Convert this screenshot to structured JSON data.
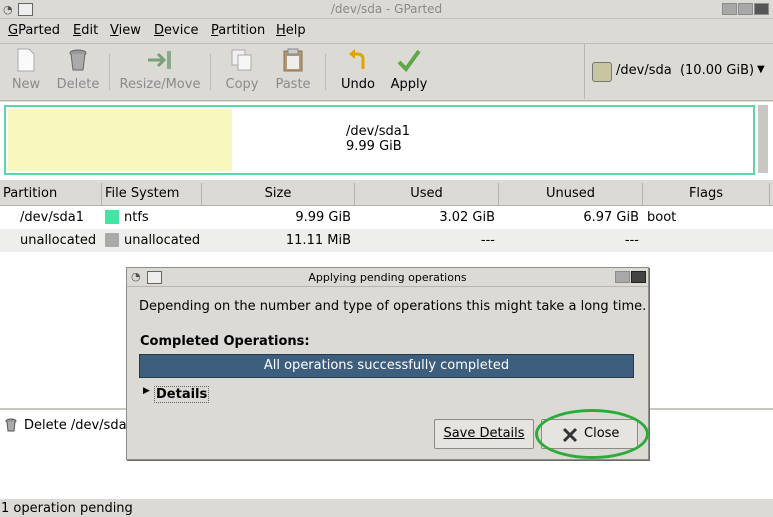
{
  "window": {
    "title": "/dev/sda - GParted"
  },
  "menubar": [
    "GParted",
    "Edit",
    "View",
    "Device",
    "Partition",
    "Help"
  ],
  "toolbar": {
    "new": "New",
    "delete": "Delete",
    "resize": "Resize/Move",
    "copy": "Copy",
    "paste": "Paste",
    "undo": "Undo",
    "apply": "Apply"
  },
  "device_selector": {
    "label": "/dev/sda  (10.00 GiB)"
  },
  "disk_map": {
    "partition_name": "/dev/sda1",
    "partition_size": "9.99 GiB",
    "used_fraction": 0.3
  },
  "table": {
    "columns": [
      "Partition",
      "File System",
      "Size",
      "Used",
      "Unused",
      "Flags"
    ],
    "rows": [
      {
        "partition": "/dev/sda1",
        "fs": "ntfs",
        "size": "9.99 GiB",
        "used": "3.02 GiB",
        "unused": "6.97 GiB",
        "flags": "boot",
        "color": "#42e6a4"
      },
      {
        "partition": "unallocated",
        "fs": "unallocated",
        "size": "11.11 MiB",
        "used": "---",
        "unused": "---",
        "flags": "",
        "color": "#a9a9a9"
      }
    ]
  },
  "pending_ops": [
    "Delete /dev/sda1"
  ],
  "statusbar": {
    "text": "1 operation pending"
  },
  "dialog": {
    "title": "Applying pending operations",
    "message": "Depending on the number and type of operations this might take a long time.",
    "completed_label": "Completed Operations:",
    "progress_text": "All operations successfully completed",
    "details_label": "Details",
    "save_details_label": "Save Details",
    "close_label": "Close"
  },
  "colors": {
    "partition_used": "#f7f7bd",
    "partition_border": "#5ad9a8",
    "progress": "#3d5f7d",
    "annotation": "#2eaa3a"
  }
}
